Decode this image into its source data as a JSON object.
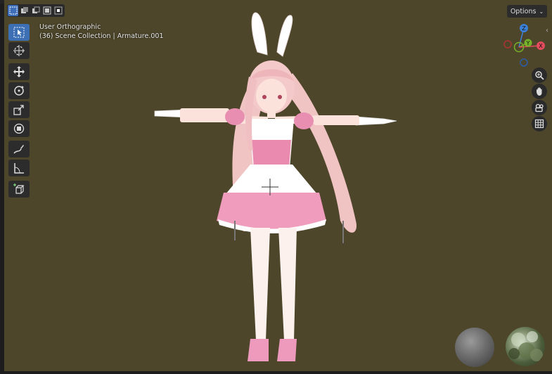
{
  "app": "Blender 3D Viewport",
  "viewport": {
    "view_name": "User Orthographic",
    "collection_info": "(36) Scene Collection | Armature.001",
    "background_color": "#4d462a"
  },
  "header": {
    "options_label": "Options",
    "selection_modes": [
      "select-box",
      "select-extend",
      "select-subtract",
      "select-invert",
      "select-intersect"
    ]
  },
  "toolbar": {
    "tools": [
      {
        "name": "select-box",
        "active": true
      },
      {
        "name": "cursor"
      },
      {
        "name": "move"
      },
      {
        "name": "rotate"
      },
      {
        "name": "scale"
      },
      {
        "name": "transform"
      },
      {
        "name": "annotate"
      },
      {
        "name": "measure"
      },
      {
        "name": "add-cube"
      }
    ]
  },
  "gizmo": {
    "axes": {
      "x": "X",
      "y": "Y",
      "z": "Z"
    },
    "colors": {
      "x": "#e44c5d",
      "y": "#76b32a",
      "z": "#3b7fd7"
    }
  },
  "nav_buttons": [
    "zoom",
    "pan",
    "camera",
    "perspective-grid"
  ],
  "accent_color": "#3d6fb5"
}
